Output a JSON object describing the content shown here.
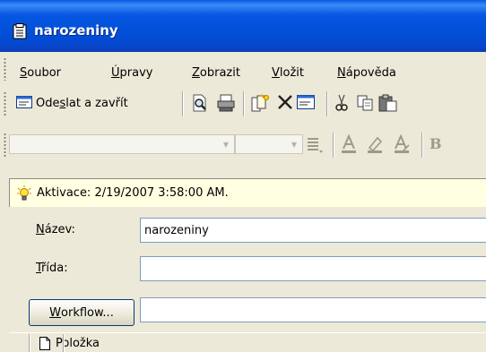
{
  "window": {
    "title": "narozeniny"
  },
  "menu": {
    "items": [
      {
        "label": "Soubor",
        "accel": "S",
        "rest": "oubor"
      },
      {
        "label": "Úpravy",
        "accel": "Ú",
        "rest": "pravy"
      },
      {
        "label": "Zobrazit",
        "accel": "Z",
        "rest": "obrazit"
      },
      {
        "label": "Vložit",
        "accel": "V",
        "rest": "ložit"
      },
      {
        "label": "Nápověda",
        "accel": "N",
        "rest": "ápověda"
      }
    ]
  },
  "toolbar": {
    "send_label_pre": "Ode",
    "send_label_accel": "s",
    "send_label_post": "lat a zavřít",
    "format_bold": "B"
  },
  "infobar": {
    "text": "Aktivace: 2/19/2007 3:58:00 AM."
  },
  "form": {
    "name_label_accel": "N",
    "name_label_rest": "ázev:",
    "name_value": "narozeniny",
    "class_label_accel": "T",
    "class_label_rest": "řída:",
    "class_value": "",
    "workflow_accel": "W",
    "workflow_rest": "orkflow...",
    "workflow_value": ""
  },
  "tabs": {
    "item_label": "Položka"
  },
  "colors": {
    "titlebar": "#0054e3",
    "info_bg": "#ffffe1",
    "window_bg": "#ece9d8"
  }
}
